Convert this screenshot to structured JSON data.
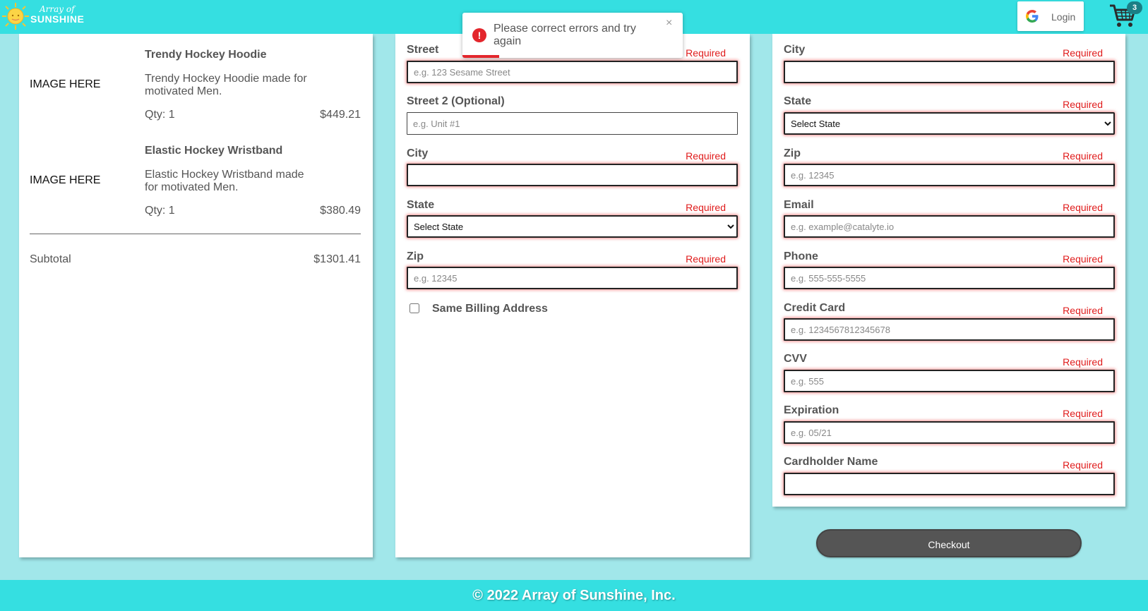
{
  "header": {
    "logo_line1": "Array of",
    "logo_line2": "SUNSHINE",
    "login_label": "Login",
    "cart_count": "3"
  },
  "toast": {
    "message": "Please correct errors and try again",
    "close": "×",
    "icon": "!"
  },
  "cart": {
    "items": [
      {
        "image": "IMAGE HERE",
        "name": "Trendy Hockey Hoodie",
        "description": "Trendy Hockey Hoodie made for motivated Men.",
        "qty": "Qty: 1",
        "price": "$449.21"
      },
      {
        "image": "IMAGE HERE",
        "name": "Elastic Hockey Wristband",
        "description": "Elastic Hockey Wristband made for motivated Men.",
        "qty": "Qty: 1",
        "price": "$380.49"
      }
    ],
    "subtotal_label": "Subtotal",
    "subtotal_value": "$1301.41"
  },
  "shipping": {
    "street_label": "Street",
    "street_placeholder": "e.g. 123 Sesame Street",
    "street2_label": "Street 2 (Optional)",
    "street2_placeholder": "e.g. Unit #1",
    "city_label": "City",
    "state_label": "State",
    "state_value": "Select State",
    "zip_label": "Zip",
    "zip_placeholder": "e.g. 12345",
    "same_billing_label": "Same Billing Address",
    "required": "Required"
  },
  "billing": {
    "city_label": "City",
    "state_label": "State",
    "state_value": "Select State",
    "zip_label": "Zip",
    "zip_placeholder": "e.g. 12345",
    "email_label": "Email",
    "email_placeholder": "e.g. example@catalyte.io",
    "phone_label": "Phone",
    "phone_placeholder": "e.g. 555-555-5555",
    "card_label": "Credit Card",
    "card_placeholder": "e.g. 1234567812345678",
    "cvv_label": "CVV",
    "cvv_placeholder": "e.g. 555",
    "exp_label": "Expiration",
    "exp_placeholder": "e.g. 05/21",
    "holder_label": "Cardholder Name",
    "required": "Required"
  },
  "checkout_label": "Checkout",
  "footer_text": "© 2022 Array of Sunshine, Inc.",
  "colors": {
    "header": "#35dfe1",
    "background": "#a1e7ea",
    "error": "#e01b1b",
    "checkout": "#555555"
  },
  "icons": [
    "sun-logo-icon",
    "google-icon",
    "cart-icon",
    "error-icon",
    "close-icon"
  ]
}
